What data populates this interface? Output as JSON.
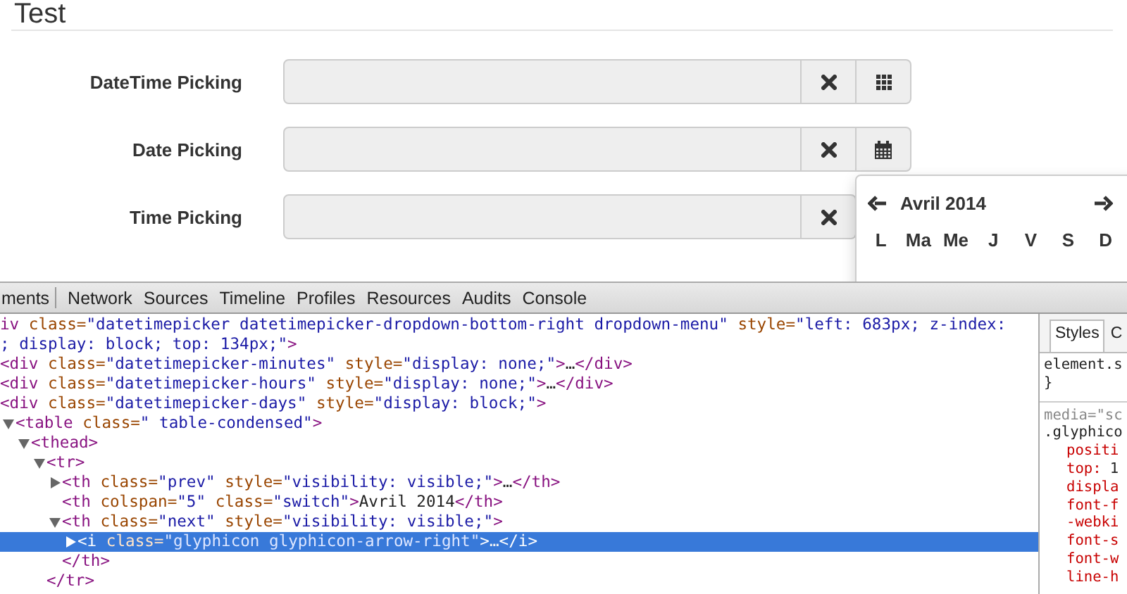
{
  "page": {
    "title": "Test"
  },
  "form": {
    "rows": [
      {
        "label": "DateTime Picking",
        "buttons": [
          {
            "kind": "clear"
          },
          {
            "kind": "grid"
          }
        ]
      },
      {
        "label": "Date Picking",
        "buttons": [
          {
            "kind": "clear"
          },
          {
            "kind": "calendar"
          }
        ]
      },
      {
        "label": "Time Picking",
        "buttons": [
          {
            "kind": "clear"
          }
        ]
      }
    ]
  },
  "calendar": {
    "month": "Avril 2014",
    "weekdays": [
      "L",
      "Ma",
      "Me",
      "J",
      "V",
      "S",
      "D"
    ]
  },
  "devtools": {
    "tabs": [
      "ments",
      "Network",
      "Sources",
      "Timeline",
      "Profiles",
      "Resources",
      "Audits",
      "Console"
    ],
    "tree": {
      "selected": false,
      "lines": [
        [
          {
            "kind": "tag",
            "text": "iv"
          },
          {
            "kind": "attr",
            "text": " class="
          },
          {
            "kind": "value",
            "text": "\"datetimepicker datetimepicker-dropdown-bottom-right dropdown-menu\""
          },
          {
            "kind": "attr",
            "text": " style="
          },
          {
            "kind": "value",
            "text": "\"left: 683px; z-index:"
          }
        ],
        [
          {
            "kind": "value",
            "text": "; display: block; top: 134px;\""
          },
          {
            "kind": "tag",
            "text": ">"
          }
        ]
      ],
      "children": [
        {
          "selected": false,
          "lines": [
            [
              {
                "kind": "tag",
                "text": "<div"
              },
              {
                "kind": "attr",
                "text": " class="
              },
              {
                "kind": "value",
                "text": "\"datetimepicker-minutes\""
              },
              {
                "kind": "attr",
                "text": " style="
              },
              {
                "kind": "value",
                "text": "\"display: none;\""
              },
              {
                "kind": "tag",
                "text": ">"
              },
              {
                "kind": "text",
                "text": "…"
              },
              {
                "kind": "tag",
                "text": "</div>"
              }
            ]
          ]
        },
        {
          "selected": false,
          "lines": [
            [
              {
                "kind": "tag",
                "text": "<div"
              },
              {
                "kind": "attr",
                "text": " class="
              },
              {
                "kind": "value",
                "text": "\"datetimepicker-hours\""
              },
              {
                "kind": "attr",
                "text": " style="
              },
              {
                "kind": "value",
                "text": "\"display: none;\""
              },
              {
                "kind": "tag",
                "text": ">"
              },
              {
                "kind": "text",
                "text": "…"
              },
              {
                "kind": "tag",
                "text": "</div>"
              }
            ]
          ]
        },
        {
          "selected": false,
          "lines": [
            [
              {
                "kind": "tag",
                "text": "<div"
              },
              {
                "kind": "attr",
                "text": " class="
              },
              {
                "kind": "value",
                "text": "\"datetimepicker-days\""
              },
              {
                "kind": "attr",
                "text": " style="
              },
              {
                "kind": "value",
                "text": "\"display: block;\""
              },
              {
                "kind": "tag",
                "text": ">"
              }
            ]
          ],
          "children": [
            {
              "selected": false,
              "expanded": true,
              "lines": [
                [
                  {
                    "kind": "tag",
                    "text": "<table"
                  },
                  {
                    "kind": "attr",
                    "text": " class="
                  },
                  {
                    "kind": "value",
                    "text": "\" table-condensed\""
                  },
                  {
                    "kind": "tag",
                    "text": ">"
                  }
                ]
              ],
              "children": [
                {
                  "selected": false,
                  "expanded": true,
                  "lines": [
                    [
                      {
                        "kind": "tag",
                        "text": "<thead>"
                      }
                    ]
                  ],
                  "children": [
                    {
                      "selected": false,
                      "expanded": true,
                      "lines": [
                        [
                          {
                            "kind": "tag",
                            "text": "<tr>"
                          }
                        ]
                      ],
                      "children": [
                        {
                          "selected": false,
                          "expanded": false,
                          "lines": [
                            [
                              {
                                "kind": "tag",
                                "text": "<th"
                              },
                              {
                                "kind": "attr",
                                "text": " class="
                              },
                              {
                                "kind": "value",
                                "text": "\"prev\""
                              },
                              {
                                "kind": "attr",
                                "text": " style="
                              },
                              {
                                "kind": "value",
                                "text": "\"visibility: visible;\""
                              },
                              {
                                "kind": "tag",
                                "text": ">"
                              },
                              {
                                "kind": "text",
                                "text": "…"
                              },
                              {
                                "kind": "tag",
                                "text": "</th>"
                              }
                            ]
                          ]
                        },
                        {
                          "selected": false,
                          "lines": [
                            [
                              {
                                "kind": "tag",
                                "text": "<th"
                              },
                              {
                                "kind": "attr",
                                "text": " colspan="
                              },
                              {
                                "kind": "value",
                                "text": "\"5\""
                              },
                              {
                                "kind": "attr",
                                "text": " class="
                              },
                              {
                                "kind": "value",
                                "text": "\"switch\""
                              },
                              {
                                "kind": "tag",
                                "text": ">"
                              },
                              {
                                "kind": "text",
                                "text": "Avril 2014"
                              },
                              {
                                "kind": "tag",
                                "text": "</th>"
                              }
                            ]
                          ]
                        },
                        {
                          "selected": false,
                          "expanded": true,
                          "lines": [
                            [
                              {
                                "kind": "tag",
                                "text": "<th"
                              },
                              {
                                "kind": "attr",
                                "text": " class="
                              },
                              {
                                "kind": "value",
                                "text": "\"next\""
                              },
                              {
                                "kind": "attr",
                                "text": " style="
                              },
                              {
                                "kind": "value",
                                "text": "\"visibility: visible;\""
                              },
                              {
                                "kind": "tag",
                                "text": ">"
                              }
                            ]
                          ],
                          "children": [
                            {
                              "selected": true,
                              "expanded": false,
                              "lines": [
                                [
                                  {
                                    "kind": "tag",
                                    "text": "<i"
                                  },
                                  {
                                    "kind": "attr",
                                    "text": " class="
                                  },
                                  {
                                    "kind": "value",
                                    "text": "\"glyphicon glyphicon-arrow-right\""
                                  },
                                  {
                                    "kind": "tag",
                                    "text": ">"
                                  },
                                  {
                                    "kind": "text",
                                    "text": "…"
                                  },
                                  {
                                    "kind": "tag",
                                    "text": "</i>"
                                  }
                                ]
                              ]
                            }
                          ],
                          "close": [
                            {
                              "kind": "tag",
                              "text": "</th>"
                            }
                          ]
                        }
                      ],
                      "close": [
                        {
                          "kind": "tag",
                          "text": "</tr>"
                        }
                      ]
                    }
                  ]
                }
              ]
            }
          ]
        }
      ]
    },
    "styles": {
      "tabs": [
        {
          "label": "Styles",
          "selected": true
        },
        {
          "label": "C",
          "selected": false
        }
      ],
      "lines": [
        {
          "kind": "selector",
          "text": "element.s"
        },
        {
          "kind": "brace",
          "text": "}"
        },
        {
          "kind": "media",
          "text": "media=\"sc"
        },
        {
          "kind": "selector",
          "text": ".glyphico"
        },
        {
          "kind": "prop",
          "name": "positi"
        },
        {
          "kind": "prop",
          "name": "top:",
          "value": "1"
        },
        {
          "kind": "prop",
          "name": "displa"
        },
        {
          "kind": "prop",
          "name": "font-f"
        },
        {
          "kind": "prop",
          "name": "-webki"
        },
        {
          "kind": "prop",
          "name": "font-s"
        },
        {
          "kind": "prop",
          "name": "font-w"
        },
        {
          "kind": "prop",
          "name": "line-h"
        }
      ]
    }
  }
}
